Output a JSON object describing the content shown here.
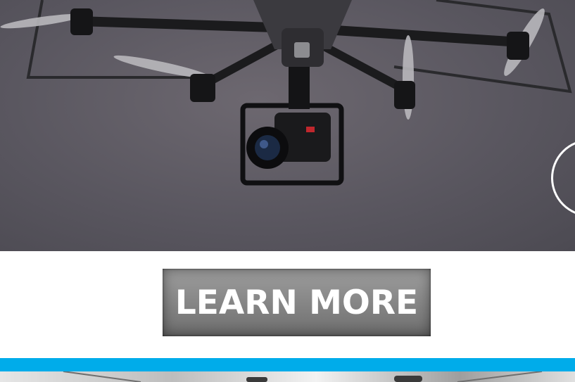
{
  "cta": {
    "label": "LEARN MORE"
  },
  "colors": {
    "accent_bar": "#00acea",
    "button_bg": "#8b8b8b",
    "hero_bg": "#5a5760"
  },
  "icons": {
    "carousel_control": "carousel-next-circle-icon"
  }
}
